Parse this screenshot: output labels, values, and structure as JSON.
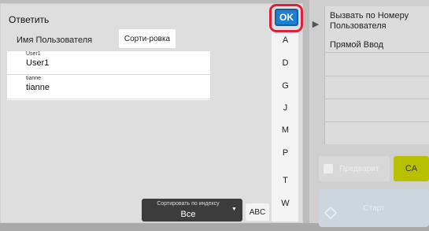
{
  "dialog": {
    "title": "Ответить",
    "column_header": "Имя Пользователя",
    "sort_button": "Сорти-ровка",
    "ok_label": "OK"
  },
  "users": [
    {
      "small": "User1",
      "name": "User1"
    },
    {
      "small": "tianne",
      "name": "tianne"
    }
  ],
  "index_letters": [
    "A",
    "D",
    "G",
    "J",
    "M",
    "P",
    "T",
    "W"
  ],
  "sort_select": {
    "label": "Сортировать по индексу",
    "value": "Все"
  },
  "abc_label": "ABC",
  "right_panel": {
    "items": [
      "Вызвать по Номеру Пользователя",
      "Прямой Ввод"
    ],
    "preview_label": "Предварит",
    "ca_label": "CA",
    "start_label": "Старт"
  },
  "colors": {
    "ok_button": "#1f7fd1",
    "ok_highlight": "#e0203a",
    "ca_button": "#b8c000"
  }
}
